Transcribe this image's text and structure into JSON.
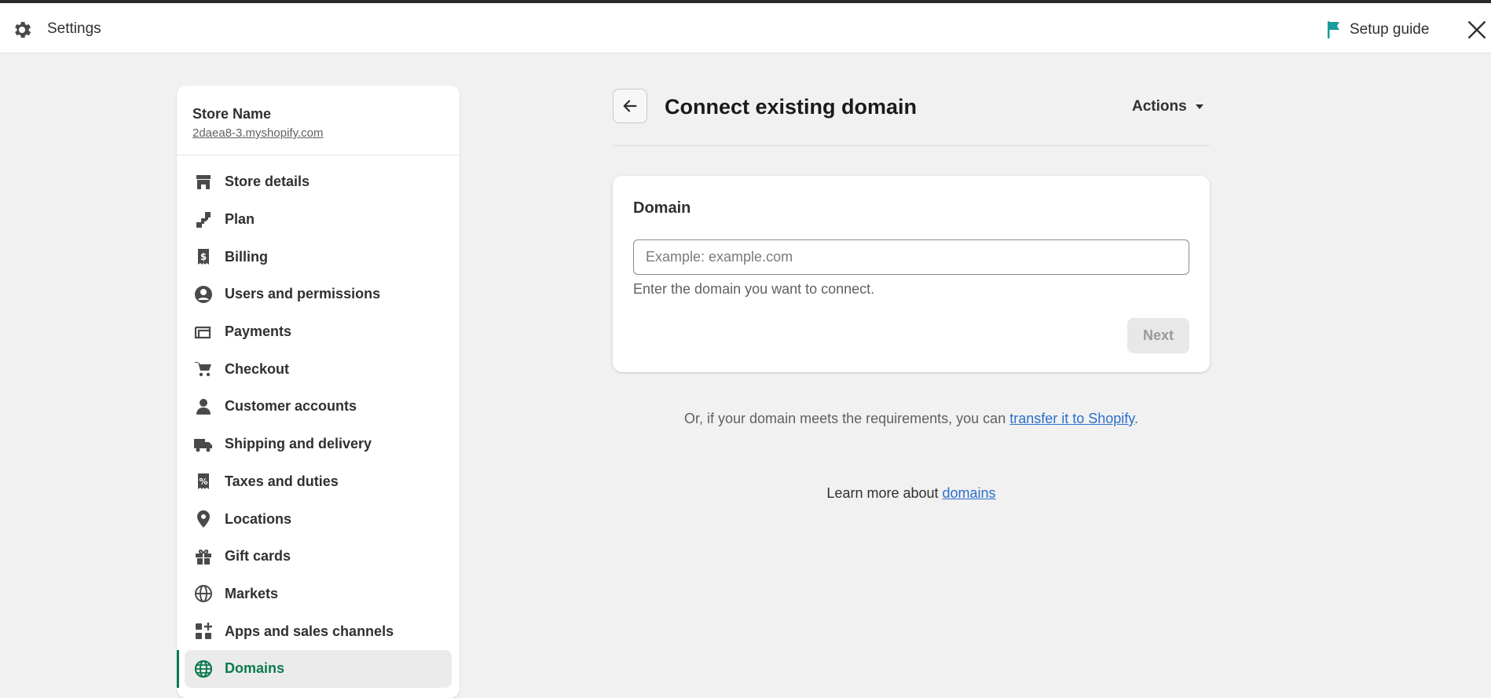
{
  "header": {
    "title": "Settings",
    "setup_guide_label": "Setup guide"
  },
  "store": {
    "name": "Store Name",
    "url": "2daea8-3.myshopify.com"
  },
  "sidebar": {
    "items": [
      {
        "label": "Store details",
        "icon": "store-icon"
      },
      {
        "label": "Plan",
        "icon": "plan-icon"
      },
      {
        "label": "Billing",
        "icon": "billing-icon"
      },
      {
        "label": "Users and permissions",
        "icon": "user-circle-icon"
      },
      {
        "label": "Payments",
        "icon": "payments-icon"
      },
      {
        "label": "Checkout",
        "icon": "cart-icon"
      },
      {
        "label": "Customer accounts",
        "icon": "person-icon"
      },
      {
        "label": "Shipping and delivery",
        "icon": "truck-icon"
      },
      {
        "label": "Taxes and duties",
        "icon": "tax-icon"
      },
      {
        "label": "Locations",
        "icon": "location-pin-icon"
      },
      {
        "label": "Gift cards",
        "icon": "gift-icon"
      },
      {
        "label": "Markets",
        "icon": "globe-markets-icon"
      },
      {
        "label": "Apps and sales channels",
        "icon": "apps-icon"
      },
      {
        "label": "Domains",
        "icon": "globe-icon",
        "active": true
      }
    ]
  },
  "main": {
    "title": "Connect existing domain",
    "actions_label": "Actions",
    "card": {
      "title": "Domain",
      "input_placeholder": "Example: example.com",
      "input_value": "",
      "help_text": "Enter the domain you want to connect.",
      "next_label": "Next"
    },
    "transfer": {
      "prefix": "Or, if your domain meets the requirements, you can ",
      "link": "transfer it to Shopify",
      "suffix": "."
    },
    "learn": {
      "prefix": "Learn more about ",
      "link": "domains"
    }
  },
  "colors": {
    "accent": "#0b7a4f",
    "link": "#2c6ecb",
    "flag": "#1a9c9c",
    "background": "#f1f1f1"
  }
}
